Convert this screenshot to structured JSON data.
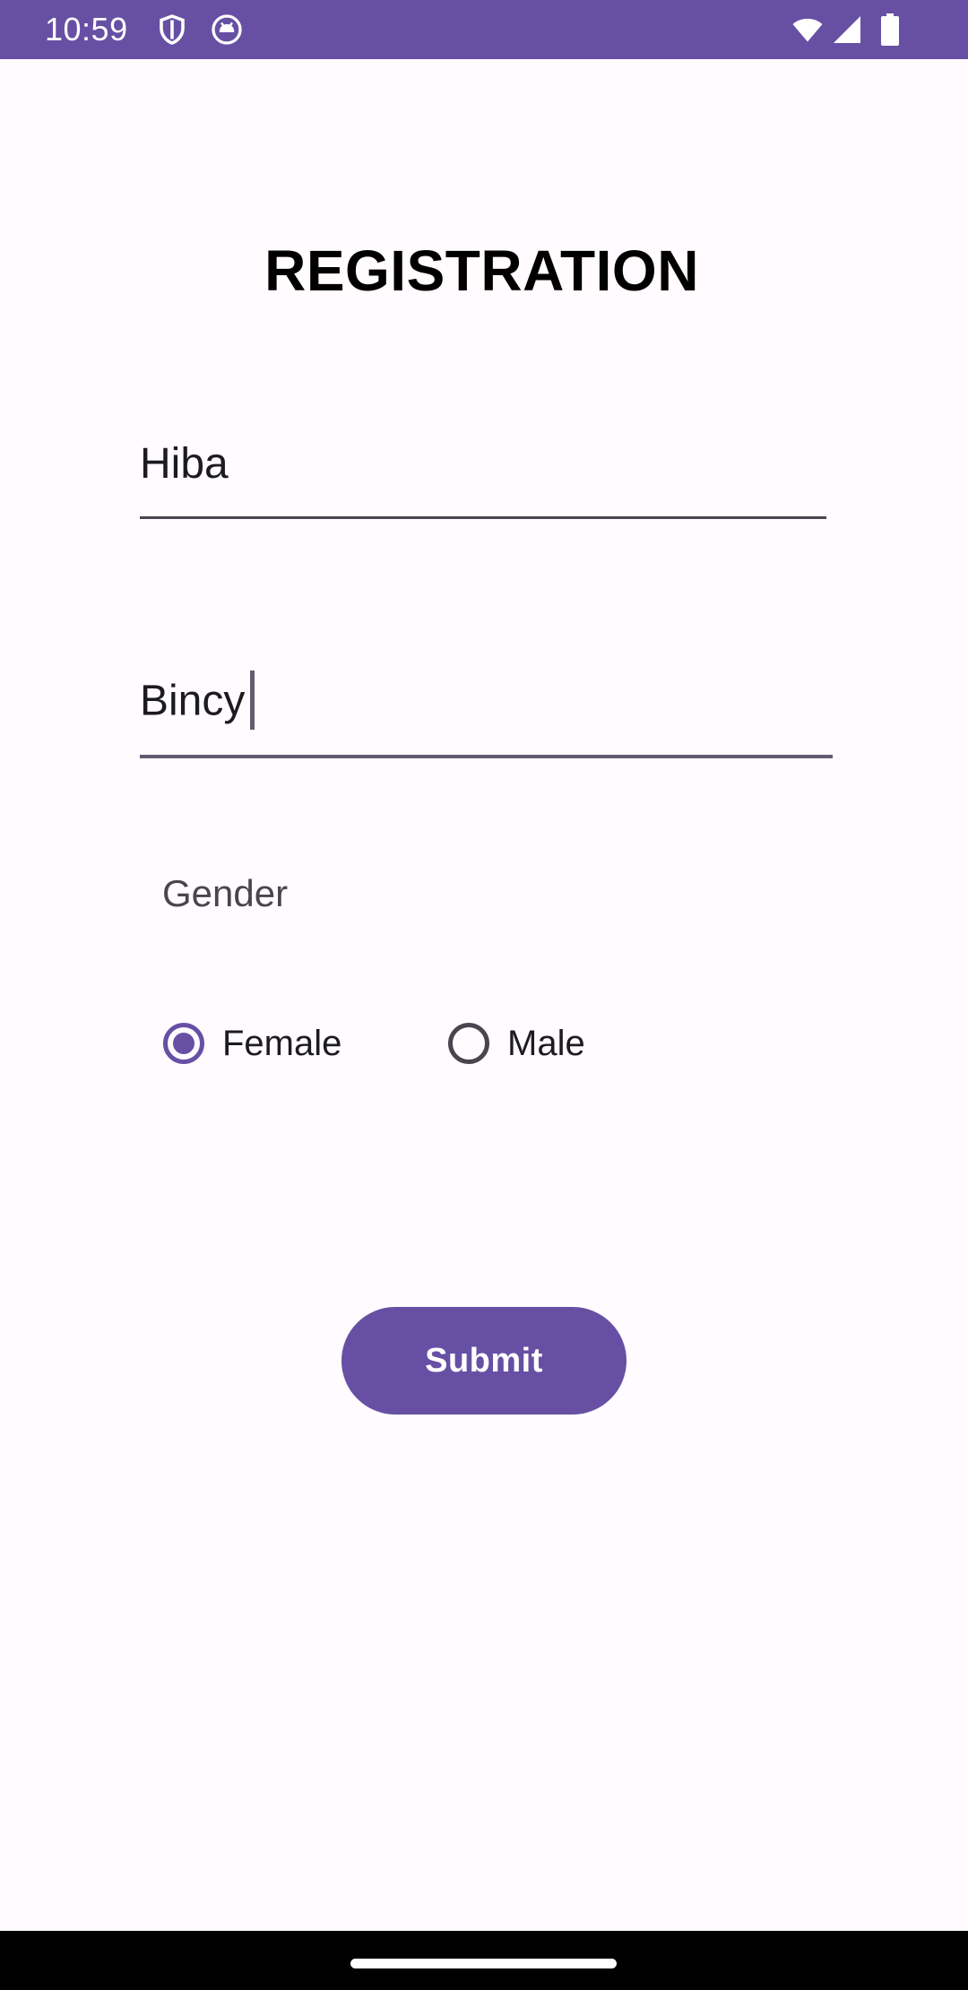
{
  "status_bar": {
    "time": "10:59",
    "left_icons": [
      "shield-icon",
      "android-icon"
    ],
    "right_icons": [
      "wifi-icon",
      "signal-icon",
      "battery-icon"
    ],
    "color": "#6750a4"
  },
  "page": {
    "title": "REGISTRATION"
  },
  "form": {
    "first_name_value": "Hiba",
    "last_name_value": "Bincy",
    "gender_label": "Gender",
    "gender_options": [
      {
        "label": "Female",
        "selected": true
      },
      {
        "label": "Male",
        "selected": false
      }
    ],
    "submit_label": "Submit"
  },
  "colors": {
    "accent": "#6750a4",
    "background": "#fffbfe",
    "text": "#1c1b1f"
  }
}
